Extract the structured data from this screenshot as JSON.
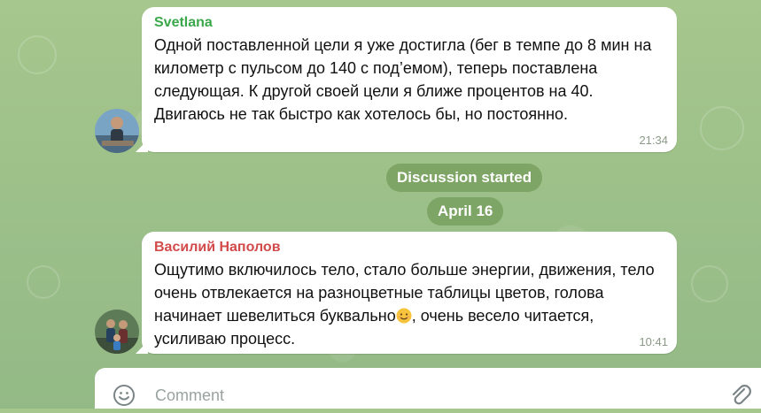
{
  "messages": [
    {
      "sender": "Svetlana",
      "sender_color": "#3aa84a",
      "text": "Одной поставленной цели я уже достигла (бег в темпе до 8 мин на километр с пульсом до 140 с под’емом), теперь поставлена следующая. К другой своей цели я ближе процентов на 40. Двигаюсь не так быстро как хотелось бы, но постоянно.",
      "time": "21:34",
      "avatar": "avatar-photo"
    },
    {
      "sender": "Василий Наполов",
      "sender_color": "#d24a4a",
      "text_before_emoji": "Ощутимо включилось тело, стало больше энергии, движения, тело очень отвлекается на разноцветные таблицы цветов, голова начинает шевелиться буквально",
      "emoji": "smiling-face-emoji",
      "text_after_emoji": ", очень весело читается, усиливаю процесс.",
      "time": "10:41",
      "avatar": "avatar-photo"
    }
  ],
  "service": {
    "discussion_started": "Discussion started",
    "date_separator": "April 16"
  },
  "composer": {
    "placeholder": "Comment",
    "emoji_icon": "smile-icon",
    "attach_icon": "paperclip-icon"
  }
}
